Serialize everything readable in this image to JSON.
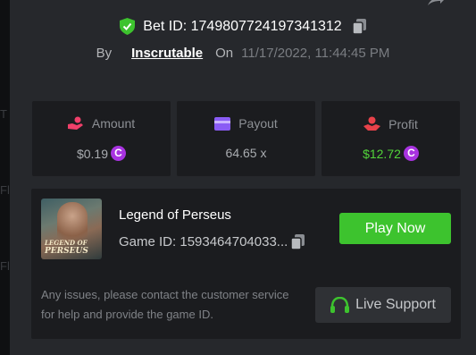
{
  "bet": {
    "id_label": "Bet ID: 1749807724197341312",
    "by_label": "By",
    "user": "Inscrutable",
    "on_label": "On",
    "date": "11/17/2022, 11:44:45 PM"
  },
  "stats": [
    {
      "label": "Amount",
      "value": "$0.19",
      "coin": "C"
    },
    {
      "label": "Payout",
      "value": "64.65 x"
    },
    {
      "label": "Profit",
      "value": "$12.72",
      "coin": "C"
    }
  ],
  "game": {
    "name": "Legend of Perseus",
    "id_label": "Game ID: 1593464704033...",
    "thumb_title_1": "LEGEND OF",
    "thumb_title_2": "PERSEUS",
    "play_label": "Play Now"
  },
  "support": {
    "issues_text": "Any issues, please contact the customer service for help and provide the game ID.",
    "button_label": "Live Support"
  },
  "colors": {
    "accent_green": "#3dc32e",
    "profit_green": "#52d43a",
    "coin_purple": "#a833e0",
    "amount_pink": "#f0406a",
    "payout_purple": "#8a5cf5",
    "profit_red": "#e8424a"
  }
}
